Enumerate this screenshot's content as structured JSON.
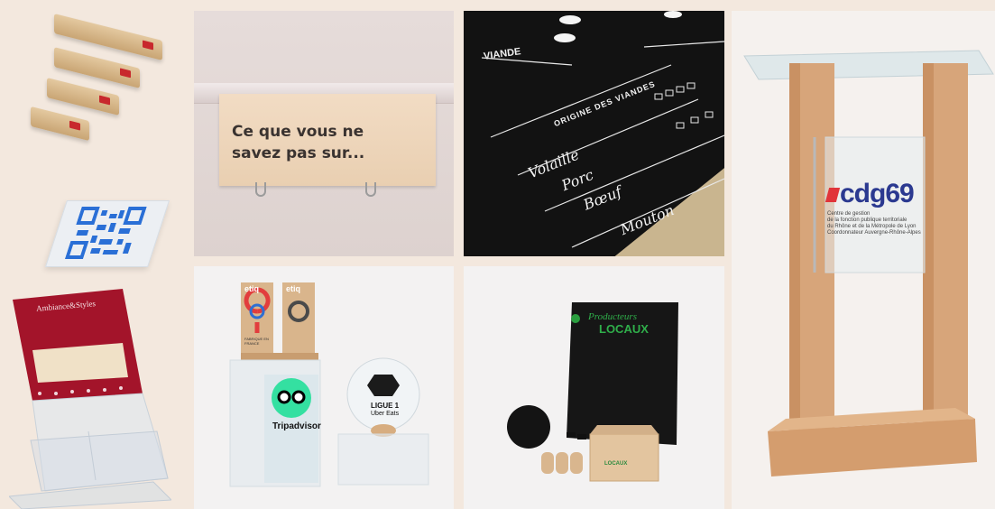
{
  "gallery": {
    "background": "#f3e8de",
    "sign": {
      "line1": "Ce que vous ne",
      "line2": "savez pas sur..."
    },
    "leaflet_holder": {
      "brand": "Ambiance&Styles"
    },
    "menu_board": {
      "header": "ORIGINE DES VIANDES",
      "top_word": "VIANDE",
      "items": [
        "Volaille",
        "Porc",
        "Bœuf",
        "Mouton"
      ]
    },
    "lectern": {
      "logo": "cdg69",
      "lines": [
        "Centre de gestion",
        "de la fonction publique territoriale",
        "du Rhône et de la Métropole de Lyon",
        "Coordonnateur Auvergne-Rhône-Alpes"
      ]
    },
    "awards": {
      "etiq": "etiq",
      "fabrique": "FABRIQUE EN FRANCE",
      "tripadvisor": "Tripadvisor",
      "ligue_line1": "LIGUE 1",
      "ligue_line2": "Uber Eats"
    },
    "producteurs": {
      "line1": "Producteurs",
      "line2": "LOCAUX"
    }
  }
}
